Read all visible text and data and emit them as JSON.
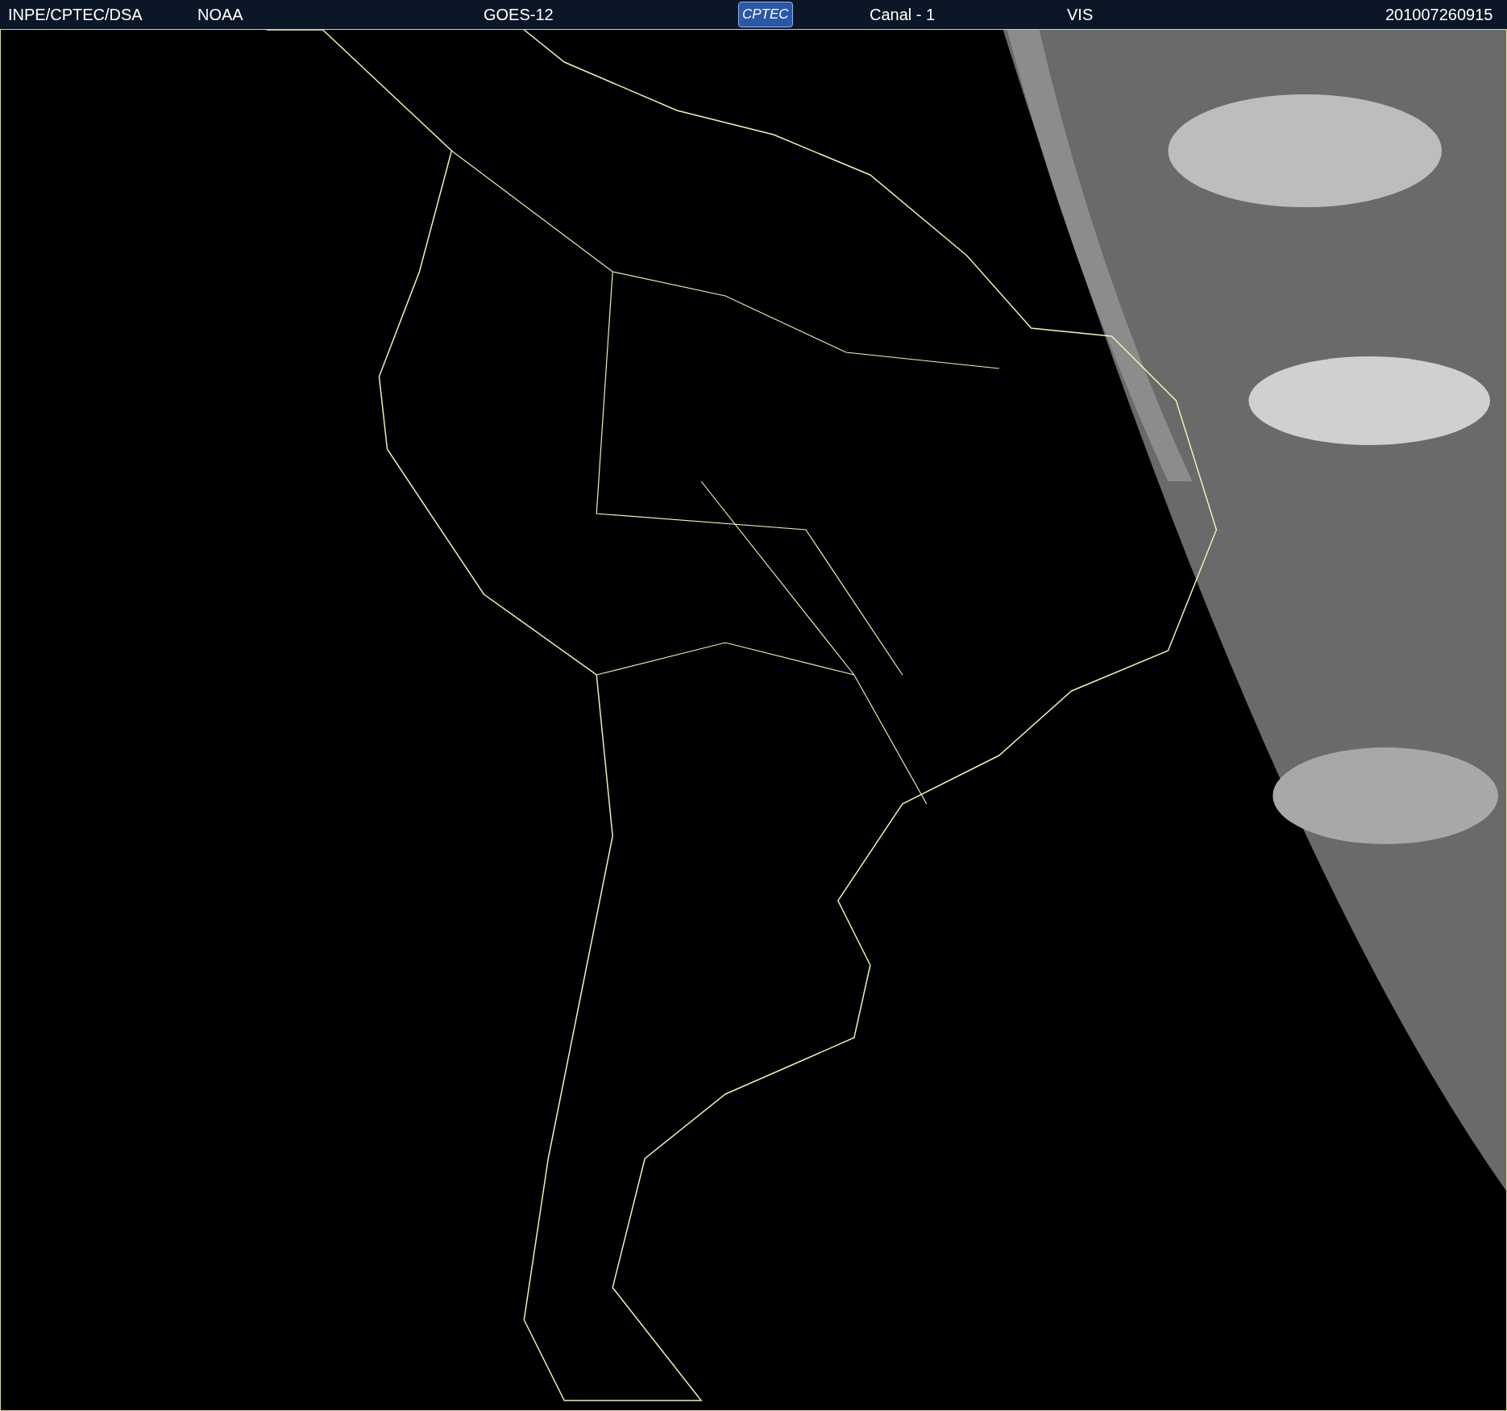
{
  "header": {
    "items": [
      {
        "text": "INPE/CPTEC/DSA"
      },
      {
        "text": "NOAA"
      },
      {
        "text": "GOES-12"
      },
      {
        "text": "CPTEC",
        "kind": "logo"
      },
      {
        "text": "Canal - 1"
      },
      {
        "text": "VIS"
      },
      {
        "text": "201007260915"
      }
    ]
  }
}
